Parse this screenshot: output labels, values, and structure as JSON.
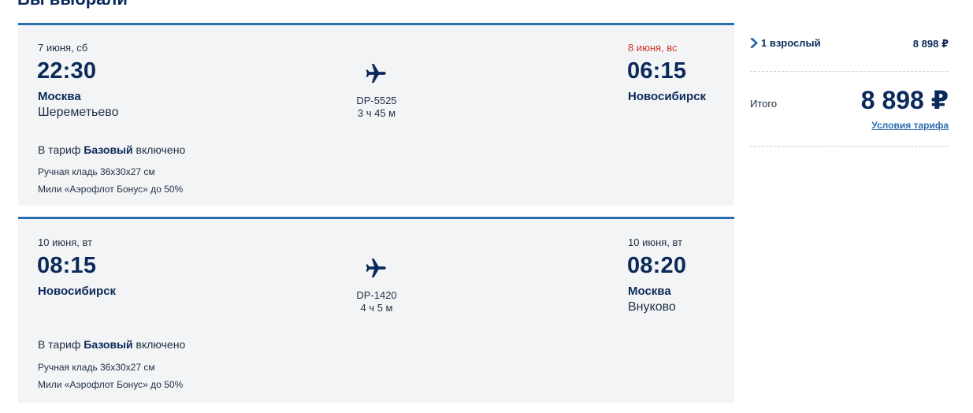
{
  "heading": "Вы выбрали",
  "flights": [
    {
      "dep_date": "7 июня, сб",
      "dep_time": "22:30",
      "dep_city": "Москва",
      "dep_airport": "Шереметьево",
      "flight_no": "DP-5525",
      "duration": "3 ч 45 м",
      "arr_date": "8 июня, вс",
      "arr_time": "06:15",
      "arr_city": "Новосибирск",
      "arr_airport": "",
      "tariff_prefix": "В тариф",
      "tariff_name": "Базовый",
      "tariff_suffix": "включено",
      "features": [
        "Ручная кладь 36x30x27 см",
        "Мили «Аэрофлот Бонус» до 50%"
      ]
    },
    {
      "dep_date": "10 июня, вт",
      "dep_time": "08:15",
      "dep_city": "Новосибирск",
      "dep_airport": "",
      "flight_no": "DP-1420",
      "duration": "4 ч 5 м",
      "arr_date": "10 июня, вт",
      "arr_time": "08:20",
      "arr_city": "Москва",
      "arr_airport": "Внуково",
      "tariff_prefix": "В тариф",
      "tariff_name": "Базовый",
      "tariff_suffix": "включено",
      "features": [
        "Ручная кладь 36x30x27 см",
        "Мили «Аэрофлот Бонус» до 50%"
      ]
    }
  ],
  "summary": {
    "passengers_label": "1 взрослый",
    "passengers_price": "8 898 ₽",
    "total_label": "Итого",
    "total_value": "8 898 ₽",
    "conditions_link": "Условия тарифа"
  },
  "colors": {
    "accent": "#2a6db0",
    "text_primary": "#0b2a5b",
    "arrival_next_day": "#d0332b",
    "card_bg": "#f3f4f5"
  },
  "icons": {
    "plane": "plane-icon",
    "chevron": "chevron-right-icon"
  }
}
